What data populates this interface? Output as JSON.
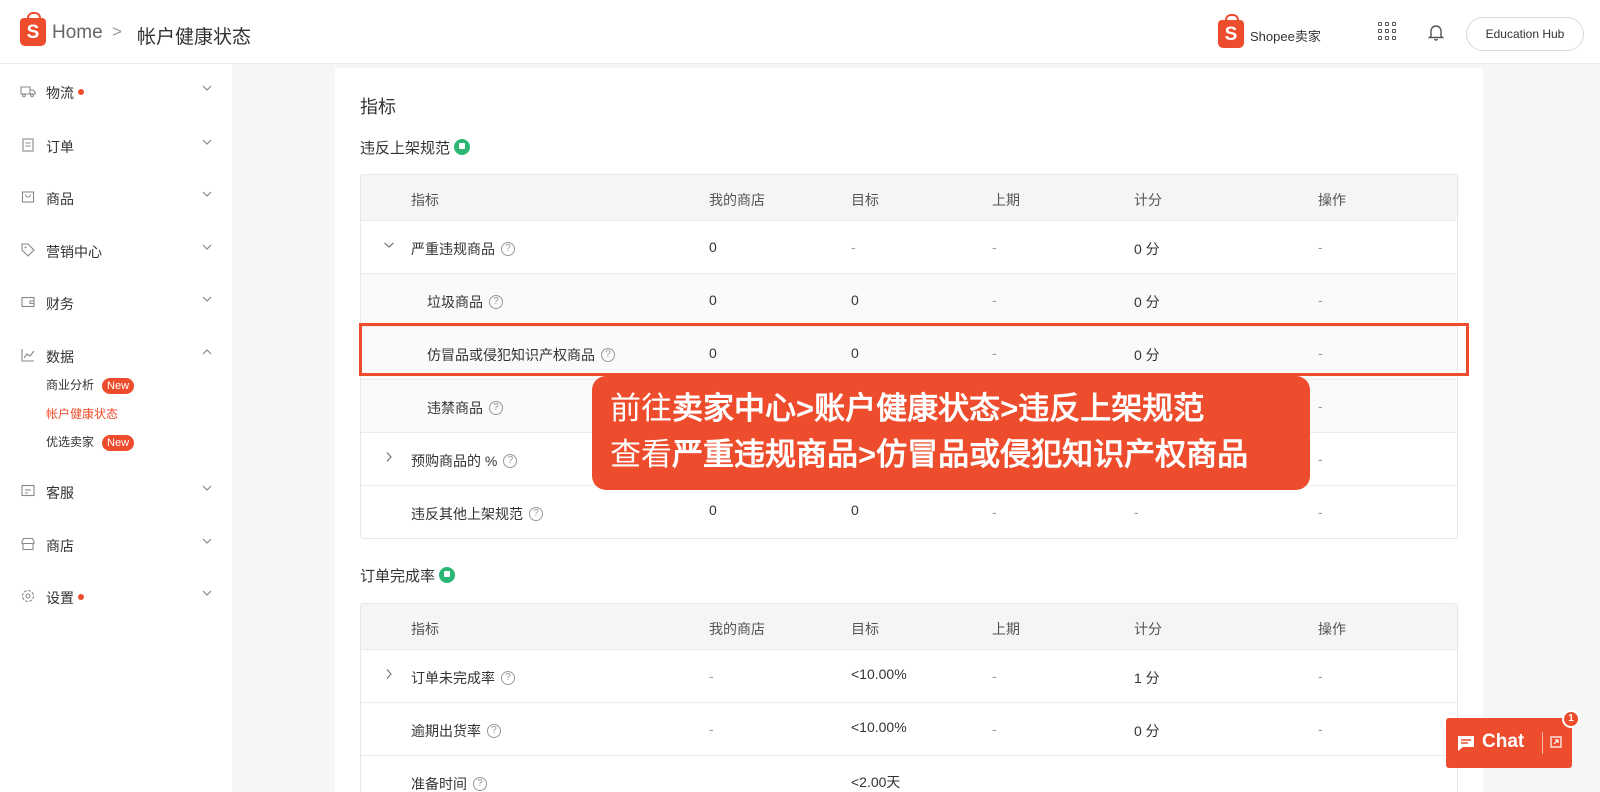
{
  "header": {
    "logo_letter": "S",
    "breadcrumb_home": "Home",
    "breadcrumb_sep": ">",
    "breadcrumb_current": "帐户健康状态",
    "brand_text": "Shopee卖家",
    "education_hub": "Education Hub"
  },
  "sidebar": {
    "items": [
      {
        "label": "物流",
        "dot": true
      },
      {
        "label": "订单"
      },
      {
        "label": "商品"
      },
      {
        "label": "营销中心"
      },
      {
        "label": "财务"
      },
      {
        "label": "数据"
      },
      {
        "label": "客服"
      },
      {
        "label": "商店"
      },
      {
        "label": "设置",
        "dot": true
      }
    ],
    "data_sub": [
      {
        "label": "商业分析",
        "badge": "New"
      },
      {
        "label": "帐户健康状态"
      },
      {
        "label": "优选卖家",
        "badge": "New"
      }
    ]
  },
  "main": {
    "title": "指标",
    "columns": [
      "指标",
      "我的商店",
      "目标",
      "上期",
      "计分",
      "操作"
    ],
    "section1": {
      "title": "违反上架规范",
      "rows": [
        {
          "name": "严重违规商品",
          "mine": "0",
          "target": "-",
          "last": "-",
          "score": "0 分",
          "action": "-"
        },
        {
          "name": "垃圾商品",
          "mine": "0",
          "target": "0",
          "last": "-",
          "score": "0 分",
          "action": "-"
        },
        {
          "name": "仿冒品或侵犯知识产权商品",
          "mine": "0",
          "target": "0",
          "last": "-",
          "score": "0 分",
          "action": "-"
        },
        {
          "name": "违禁商品",
          "action": "-"
        },
        {
          "name": "预购商品的 %",
          "action": "-"
        },
        {
          "name": "违反其他上架规范",
          "mine": "0",
          "target": "0",
          "last": "-",
          "score": "-",
          "action": "-"
        }
      ]
    },
    "section2": {
      "title": "订单完成率",
      "rows": [
        {
          "name": "订单未完成率",
          "mine": "-",
          "target": "<10.00%",
          "last": "-",
          "score": "1 分",
          "action": "-"
        },
        {
          "name": "逾期出货率",
          "mine": "-",
          "target": "<10.00%",
          "last": "-",
          "score": "0 分",
          "action": "-"
        },
        {
          "name": "准备时间",
          "target": "<2.00天"
        }
      ]
    }
  },
  "callout": {
    "line1_a": "前往",
    "line1_b": "卖家中心>账户健康状态>违反上架规范",
    "line2_a": "查看",
    "line2_b": "严重违规商品>仿冒品或侵犯知识产权商品"
  },
  "chat": {
    "label": "Chat",
    "badge": "1"
  },
  "colors": {
    "brand": "#ee4d2d",
    "thumb": "#2bb673"
  }
}
